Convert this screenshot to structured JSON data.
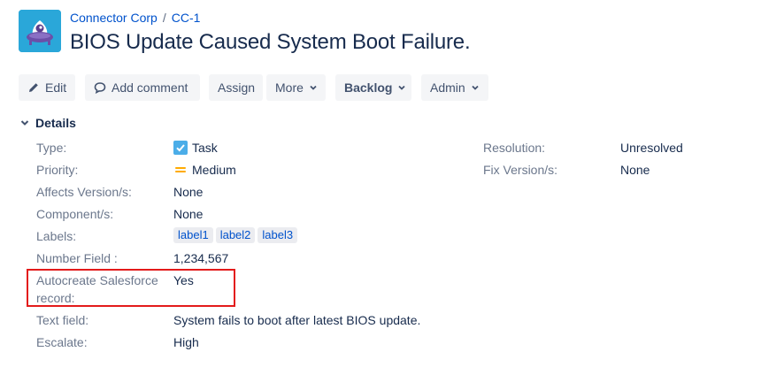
{
  "breadcrumb": {
    "project": "Connector Corp",
    "separator": "/",
    "issue_key": "CC-1"
  },
  "issue": {
    "title": "BIOS Update Caused System Boot Failure."
  },
  "toolbar": {
    "edit": "Edit",
    "add_comment": "Add comment",
    "assign": "Assign",
    "more": "More",
    "status": "Backlog",
    "admin": "Admin"
  },
  "details": {
    "heading": "Details",
    "type": {
      "label": "Type:",
      "value": "Task"
    },
    "priority": {
      "label": "Priority:",
      "value": "Medium"
    },
    "affects_version": {
      "label": "Affects Version/s:",
      "value": "None"
    },
    "component": {
      "label": "Component/s:",
      "value": "None"
    },
    "labels": {
      "label": "Labels:",
      "values": [
        "label1",
        "label2",
        "label3"
      ]
    },
    "number_field": {
      "label": "Number Field :",
      "value": "1,234,567"
    },
    "autocreate": {
      "label_line1": "Autocreate Salesforce",
      "label_line2": "record:",
      "value": "Yes"
    },
    "text_field": {
      "label": "Text field:",
      "value": "System fails to boot after latest BIOS update."
    },
    "escalate": {
      "label": "Escalate:",
      "value": "High"
    },
    "resolution": {
      "label": "Resolution:",
      "value": "Unresolved"
    },
    "fix_version": {
      "label": "Fix Version/s:",
      "value": "None"
    }
  },
  "colors": {
    "link": "#0052cc",
    "highlight": "#e31b1b",
    "task_icon": "#4bade8",
    "priority_medium": "#ffab00"
  },
  "icons": {
    "project_avatar": "alien-ufo-icon",
    "edit": "pencil-icon",
    "comment": "speech-bubble-icon",
    "dropdown": "chevron-down-icon",
    "section": "chevron-down-icon",
    "type": "checkbox-task-icon",
    "priority": "priority-medium-icon"
  }
}
